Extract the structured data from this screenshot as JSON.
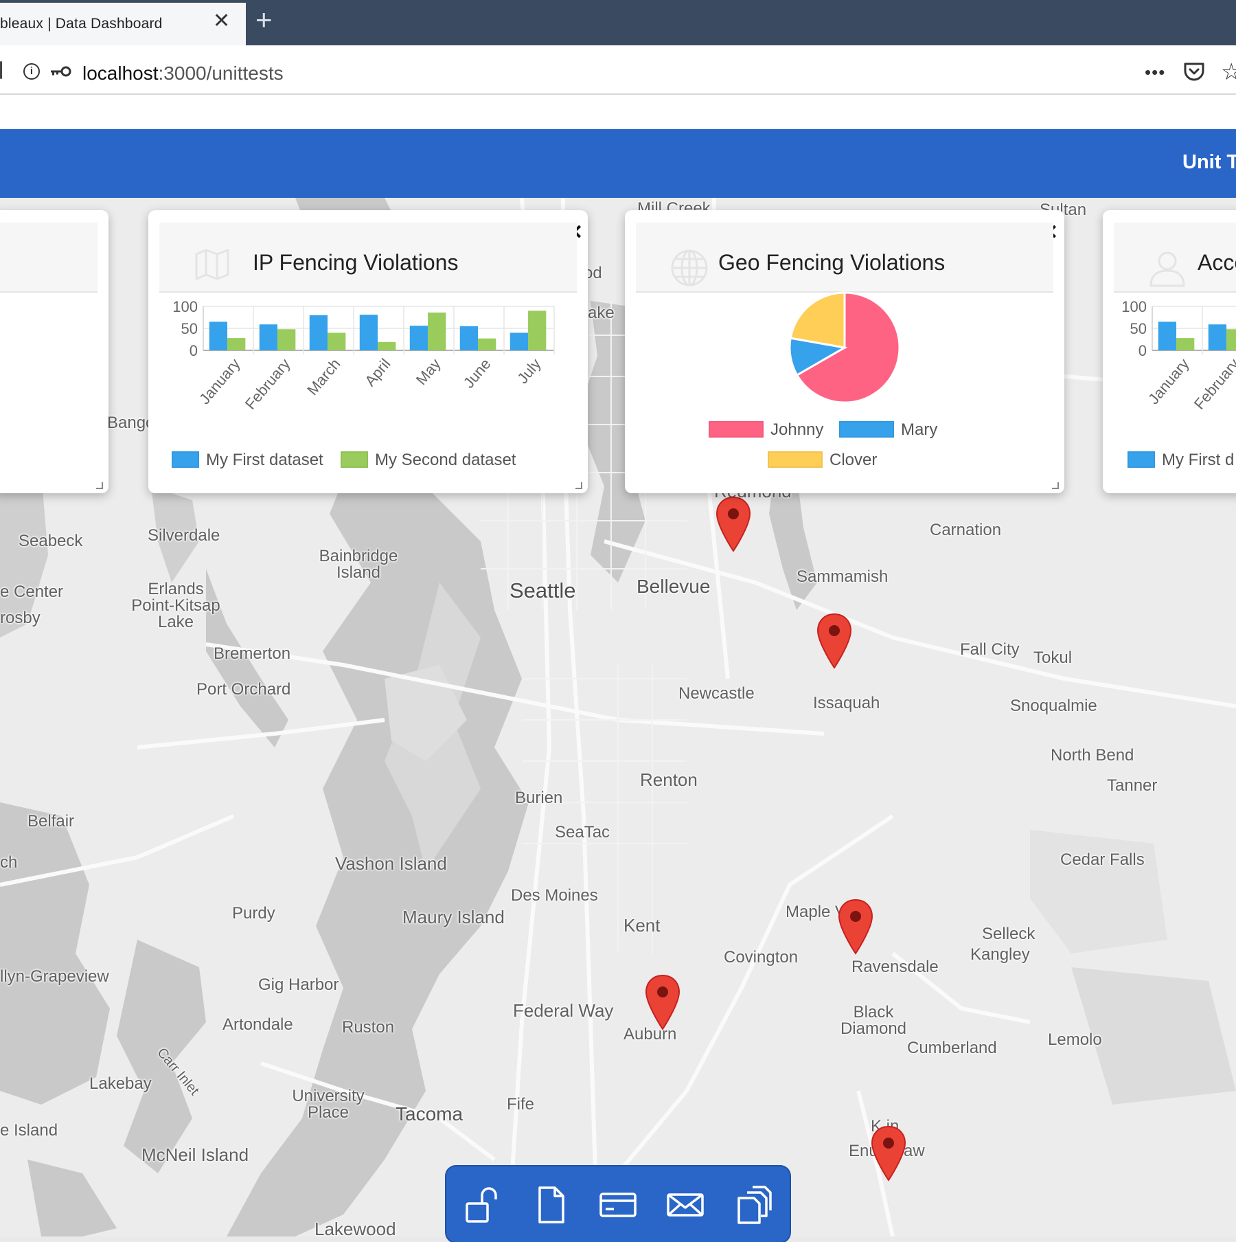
{
  "browser": {
    "tab_title": "bleaux | Data Dashboard",
    "url_host": "localhost",
    "url_rest": ":3000/unittests"
  },
  "app": {
    "header_title": "Unit T"
  },
  "cards": {
    "left_partial": {},
    "ip": {
      "title": "IP Fencing Violations",
      "legend": [
        "My First dataset",
        "My Second dataset"
      ]
    },
    "geo": {
      "title": "Geo Fencing Violations",
      "legend": [
        "Johnny",
        "Mary",
        "Clover"
      ]
    },
    "access_partial": {
      "title": "Acce",
      "legend": [
        "My First d"
      ]
    }
  },
  "chart_data": [
    {
      "type": "bar",
      "title": "IP Fencing Violations",
      "categories": [
        "January",
        "February",
        "March",
        "April",
        "May",
        "June",
        "July"
      ],
      "series": [
        {
          "name": "My First dataset",
          "values": [
            65,
            59,
            80,
            81,
            56,
            55,
            40
          ],
          "color": "#36a2eb"
        },
        {
          "name": "My Second dataset",
          "values": [
            28,
            48,
            40,
            19,
            86,
            27,
            90
          ],
          "color": "#99cc5c"
        }
      ],
      "yticks": [
        "100",
        "50",
        "0"
      ],
      "ylim": [
        0,
        100
      ]
    },
    {
      "type": "pie",
      "title": "Geo Fencing Violations",
      "labels": [
        "Johnny",
        "Mary",
        "Clover"
      ],
      "values": [
        300,
        50,
        100
      ],
      "colors": [
        "#ff6384",
        "#36a2eb",
        "#ffce56"
      ]
    },
    {
      "type": "bar",
      "title": "Acce",
      "categories": [
        "January",
        "February"
      ],
      "series": [
        {
          "name": "My First d",
          "values": [
            65,
            59
          ],
          "color": "#36a2eb"
        },
        {
          "name": "",
          "values": [
            28,
            48
          ],
          "color": "#99cc5c"
        }
      ],
      "yticks": [
        "100",
        "50",
        "0"
      ],
      "ylim": [
        0,
        100
      ]
    }
  ],
  "map": {
    "places": [
      {
        "name": "Seattle",
        "size": "big"
      },
      {
        "name": "Bellevue",
        "size": "mid"
      },
      {
        "name": "Tacoma",
        "size": "mid"
      },
      {
        "name": "Renton",
        "size": "mid"
      },
      {
        "name": "Kent",
        "size": "mid"
      },
      {
        "name": "Federal Way",
        "size": "mid"
      },
      {
        "name": "Seabeck"
      },
      {
        "name": "Silverdale"
      },
      {
        "name": "Bainbridge Island"
      },
      {
        "name": "e Center"
      },
      {
        "name": "Erlands Point-Kitsap Lake"
      },
      {
        "name": "rosby"
      },
      {
        "name": "Bremerton"
      },
      {
        "name": "Port Orchard"
      },
      {
        "name": "Newcastle"
      },
      {
        "name": "Issaquah"
      },
      {
        "name": "Sammamish"
      },
      {
        "name": "Carnation"
      },
      {
        "name": "Fall City"
      },
      {
        "name": "Tokul"
      },
      {
        "name": "Snoqualmie"
      },
      {
        "name": "North Bend"
      },
      {
        "name": "Tanner"
      },
      {
        "name": "Burien"
      },
      {
        "name": "SeaTac"
      },
      {
        "name": "Belfair"
      },
      {
        "name": "ch"
      },
      {
        "name": "Vashon Island"
      },
      {
        "name": "Des Moines"
      },
      {
        "name": "Purdy"
      },
      {
        "name": "Maury Island"
      },
      {
        "name": "Maple V  y"
      },
      {
        "name": "Covington"
      },
      {
        "name": "Ravensdale"
      },
      {
        "name": "Selleck"
      },
      {
        "name": "Kangley"
      },
      {
        "name": "Cedar Falls"
      },
      {
        "name": "llyn-Grapeview"
      },
      {
        "name": "Gig Harbor"
      },
      {
        "name": "Artondale"
      },
      {
        "name": "Ruston"
      },
      {
        "name": "Auburn"
      },
      {
        "name": "Black Diamond"
      },
      {
        "name": "Cumberland"
      },
      {
        "name": "Lemolo"
      },
      {
        "name": "Lakebay"
      },
      {
        "name": "Carr Inlet"
      },
      {
        "name": "University Place"
      },
      {
        "name": "Fife"
      },
      {
        "name": "e Island"
      },
      {
        "name": "McNeil Island"
      },
      {
        "name": "Enumclaw"
      },
      {
        "name": "Lakewood"
      },
      {
        "name": "K  in"
      },
      {
        "name": "Redmond"
      },
      {
        "name": "Sultan"
      },
      {
        "name": "Mill Creek"
      },
      {
        "name": "Bango"
      },
      {
        "name": "od"
      },
      {
        "name": "ake"
      }
    ]
  },
  "toolbar": {
    "icons": [
      "unlock-icon",
      "document-icon",
      "credit-card-icon",
      "mail-icon",
      "copy-icon"
    ]
  },
  "colors": {
    "header_blue": "#2966c8",
    "tab_bar": "#3a4a60",
    "pin_red": "#ea4335"
  }
}
